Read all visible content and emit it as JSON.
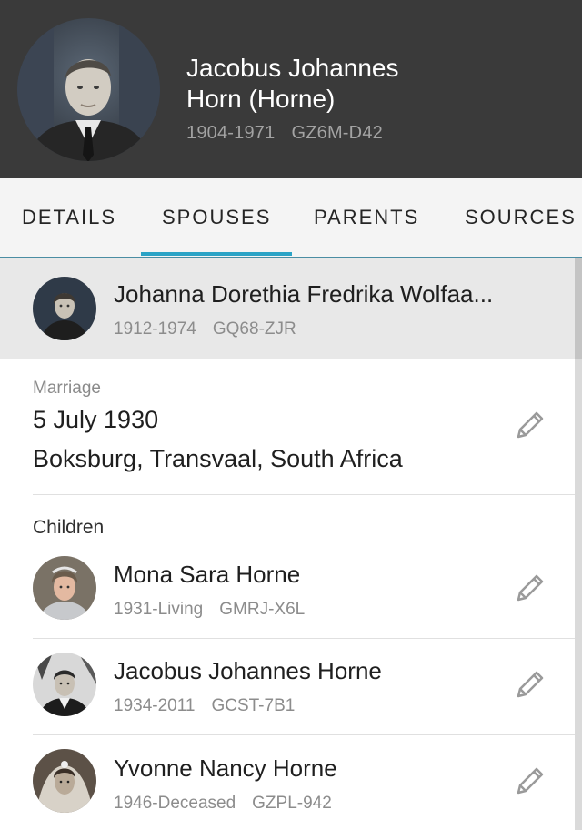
{
  "person": {
    "name_line1": "Jacobus Johannes",
    "name_line2": "Horn (Horne)",
    "lifespan": "1904-1971",
    "id": "GZ6M-D42"
  },
  "tabs": [
    {
      "label": "DETAILS",
      "active": false
    },
    {
      "label": "SPOUSES",
      "active": true
    },
    {
      "label": "PARENTS",
      "active": false
    },
    {
      "label": "SOURCES",
      "active": false
    }
  ],
  "spouse": {
    "name": "Johanna Dorethia Fredrika Wolfaa...",
    "lifespan": "1912-1974",
    "id": "GQ68-ZJR"
  },
  "marriage": {
    "label": "Marriage",
    "date": "5 July 1930",
    "place": "Boksburg, Transvaal, South Africa",
    "edit_icon": "pencil-icon"
  },
  "children_section": {
    "label": "Children",
    "items": [
      {
        "name": "Mona Sara Horne",
        "lifespan": "1931-Living",
        "id": "GMRJ-X6L"
      },
      {
        "name": "Jacobus Johannes Horne",
        "lifespan": "1934-2011",
        "id": "GCST-7B1"
      },
      {
        "name": "Yvonne Nancy Horne",
        "lifespan": "1946-Deceased",
        "id": "GZPL-942"
      }
    ]
  },
  "colors": {
    "header_bg": "#3a3a3a",
    "tab_accent": "#2aa3c6",
    "selected_row_bg": "#e8e8e8"
  }
}
